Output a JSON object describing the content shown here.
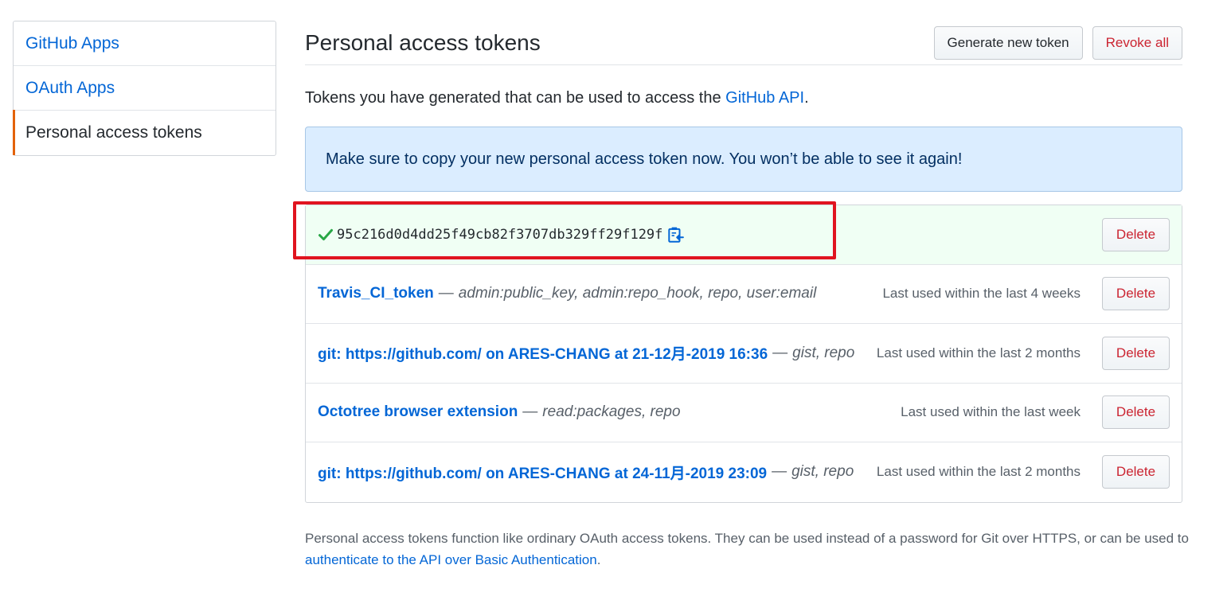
{
  "sidebar": {
    "items": [
      {
        "label": "GitHub Apps"
      },
      {
        "label": "OAuth Apps"
      },
      {
        "label": "Personal access tokens"
      }
    ]
  },
  "header": {
    "title": "Personal access tokens",
    "generate_label": "Generate new token",
    "revoke_label": "Revoke all"
  },
  "intro": {
    "text": "Tokens you have generated that can be used to access the ",
    "link": "GitHub API",
    "suffix": "."
  },
  "flash": {
    "message": "Make sure to copy your new personal access token now. You won’t be able to see it again!"
  },
  "new_token": {
    "value": "95c216d0d4dd25f49cb82f3707db329ff29f129f",
    "delete_label": "Delete"
  },
  "tokens": [
    {
      "name": "Travis_CI_token",
      "separator": "—",
      "scopes": "admin:public_key, admin:repo_hook, repo, user:email",
      "last_used": "Last used within the last 4 weeks",
      "delete_label": "Delete"
    },
    {
      "name": "git: https://github.com/ on ARES-CHANG at 21-12月-2019 16:36",
      "separator": "—",
      "scopes": "gist, repo",
      "last_used": "Last used within the last 2 months",
      "delete_label": "Delete"
    },
    {
      "name": "Octotree browser extension",
      "separator": "—",
      "scopes": "read:packages, repo",
      "last_used": "Last used within the last week",
      "delete_label": "Delete"
    },
    {
      "name": "git: https://github.com/ on ARES-CHANG at 24-11月-2019 23:09",
      "separator": "—",
      "scopes": "gist, repo",
      "last_used": "Last used within the last 2 months",
      "delete_label": "Delete"
    }
  ],
  "footnote": {
    "text": "Personal access tokens function like ordinary OAuth access tokens. They can be used instead of a password for Git over HTTPS, or can be used to ",
    "link": "authenticate to the API over Basic Authentication",
    "suffix": "."
  },
  "colors": {
    "link": "#0366d6",
    "danger": "#cb2431",
    "selected_indicator": "#e36209",
    "annotation": "#e0141f",
    "success": "#28a745"
  },
  "icons": {
    "check": "check-icon",
    "copy": "clippy-icon"
  }
}
